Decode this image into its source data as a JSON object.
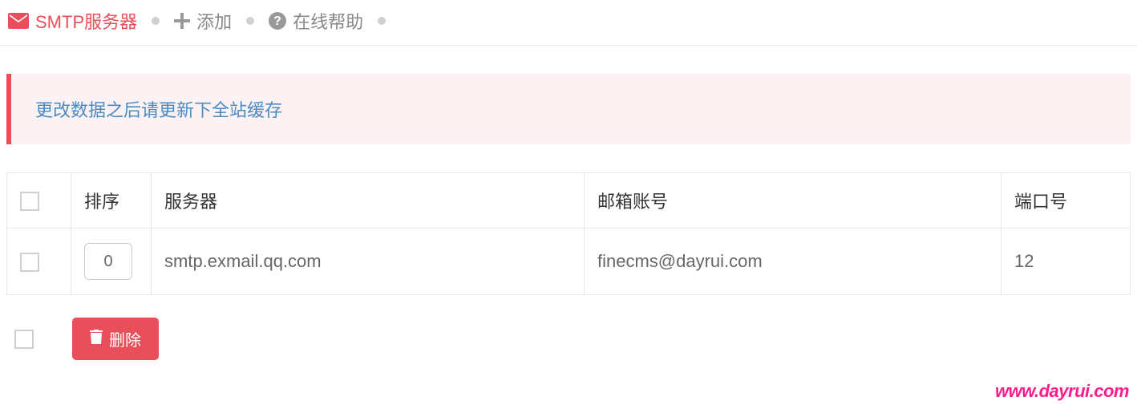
{
  "nav": {
    "smtp_label": "SMTP服务器",
    "add_label": "添加",
    "help_label": "在线帮助"
  },
  "alert": {
    "message": "更改数据之后请更新下全站缓存"
  },
  "table": {
    "headers": {
      "sort": "排序",
      "server": "服务器",
      "email": "邮箱账号",
      "port": "端口号"
    },
    "rows": [
      {
        "sort": "0",
        "server": "smtp.exmail.qq.com",
        "email": "finecms@dayrui.com",
        "port": "12"
      }
    ]
  },
  "footer": {
    "delete_label": "删除"
  },
  "watermark": "www.dayrui.com"
}
